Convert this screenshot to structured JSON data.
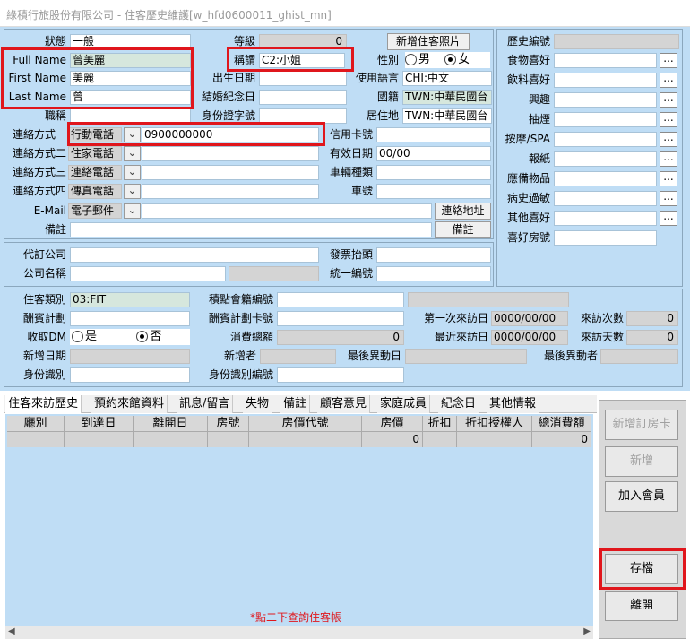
{
  "window": {
    "title": "綠積行旅股份有限公司 - 住客歷史維護[w_hfd0600011_ghist_mn]"
  },
  "form": {
    "status": {
      "label": "狀態",
      "value": "一般"
    },
    "level": {
      "label": "等級",
      "value": "0"
    },
    "add_photo_button": "新增住客照片",
    "full_name": {
      "label": "Full Name",
      "value": "曾美麗"
    },
    "first_name": {
      "label": "First Name",
      "value": "美麗"
    },
    "last_name": {
      "label": "Last Name",
      "value": "曾"
    },
    "job_title": {
      "label": "職稱",
      "value": ""
    },
    "title": {
      "label": "稱謂",
      "value": "C2:小姐"
    },
    "birthday": {
      "label": "出生日期",
      "value": ""
    },
    "anniversary": {
      "label": "結婚紀念日",
      "value": ""
    },
    "id_no": {
      "label": "身份證字號",
      "value": ""
    },
    "gender": {
      "label": "性別",
      "male": "男",
      "female": "女",
      "selected": "female"
    },
    "language": {
      "label": "使用語言",
      "value": "CHI:中文"
    },
    "nationality": {
      "label": "國籍",
      "value": "TWN:中華民國台"
    },
    "residence": {
      "label": "居住地",
      "value": "TWN:中華民國台"
    },
    "contacts": [
      {
        "label": "連絡方式一",
        "type": "行動電話",
        "value": "0900000000"
      },
      {
        "label": "連絡方式二",
        "type": "住家電話",
        "value": ""
      },
      {
        "label": "連絡方式三",
        "type": "連絡電話",
        "value": ""
      },
      {
        "label": "連絡方式四",
        "type": "傳真電話",
        "value": ""
      }
    ],
    "email": {
      "label": "E-Mail",
      "type": "電子郵件",
      "value": ""
    },
    "contact_address_button": "連絡地址",
    "remark": {
      "label": "備註",
      "value": ""
    },
    "remark_button": "備註",
    "credit_card": {
      "label": "信用卡號",
      "value": ""
    },
    "expiry": {
      "label": "有效日期",
      "value": "00/00"
    },
    "car_type": {
      "label": "車輛種類",
      "value": ""
    },
    "plate": {
      "label": "車號",
      "value": ""
    },
    "agency": {
      "label": "代訂公司",
      "value": ""
    },
    "company": {
      "label": "公司名稱",
      "value": ""
    },
    "invoice_title": {
      "label": "發票抬頭",
      "value": ""
    },
    "tax_id": {
      "label": "統一編號",
      "value": ""
    }
  },
  "prefs": {
    "history_no": {
      "label": "歷史編號",
      "value": ""
    },
    "items": [
      {
        "label": "食物喜好",
        "value": ""
      },
      {
        "label": "飲料喜好",
        "value": ""
      },
      {
        "label": "興趣",
        "value": ""
      },
      {
        "label": "抽煙",
        "value": ""
      },
      {
        "label": "按摩/SPA",
        "value": ""
      },
      {
        "label": "報紙",
        "value": ""
      },
      {
        "label": "應備物品",
        "value": ""
      },
      {
        "label": "病史過敏",
        "value": ""
      },
      {
        "label": "其他喜好",
        "value": ""
      }
    ],
    "room_pref": {
      "label": "喜好房號",
      "value": ""
    },
    "ellipsis": "..."
  },
  "stats": {
    "guest_type": {
      "label": "住客類別",
      "value": "03:FIT"
    },
    "points_no": {
      "label": "積點會籍編號",
      "value": ""
    },
    "reward_plan": {
      "label": "酬賓計劃",
      "value": ""
    },
    "reward_card": {
      "label": "酬賓計劃卡號",
      "value": ""
    },
    "first_visit": {
      "label": "第一次來訪日",
      "value": "0000/00/00"
    },
    "visit_count": {
      "label": "來訪次數",
      "value": "0"
    },
    "dm": {
      "label": "收取DM",
      "yes": "是",
      "no": "否",
      "selected": "no"
    },
    "total_spend": {
      "label": "消費總額",
      "value": "0"
    },
    "last_visit": {
      "label": "最近來訪日",
      "value": "0000/00/00"
    },
    "visit_days": {
      "label": "來訪天數",
      "value": "0"
    },
    "created_date": {
      "label": "新增日期",
      "value": ""
    },
    "creator": {
      "label": "新增者",
      "value": ""
    },
    "last_modified": {
      "label": "最後異動日",
      "value": ""
    },
    "last_modifier": {
      "label": "最後異動者",
      "value": ""
    },
    "identity": {
      "label": "身份識別",
      "value": ""
    },
    "identity_no": {
      "label": "身份識別編號",
      "value": ""
    }
  },
  "tabs": [
    "住客來訪歷史",
    "預約來館資料",
    "訊息/留言",
    "失物",
    "備註",
    "顧客意見",
    "家庭成員",
    "紀念日",
    "其他情報"
  ],
  "grid": {
    "columns": [
      "廳別",
      "到達日",
      "離開日",
      "房號",
      "房價代號",
      "房價",
      "折扣",
      "折扣授權人",
      "總消費額"
    ],
    "row": [
      "",
      "",
      "",
      "",
      "",
      "0",
      "",
      "",
      "0"
    ],
    "hint": "*點二下查詢住客帳"
  },
  "side_buttons": {
    "new_booking": "新增訂房卡",
    "add": "新增",
    "join_member": "加入會員",
    "save": "存檔",
    "leave": "離開"
  },
  "colors": {
    "background": "#bfddf5",
    "highlight": "#e0161c",
    "hint": "#e0161c"
  }
}
